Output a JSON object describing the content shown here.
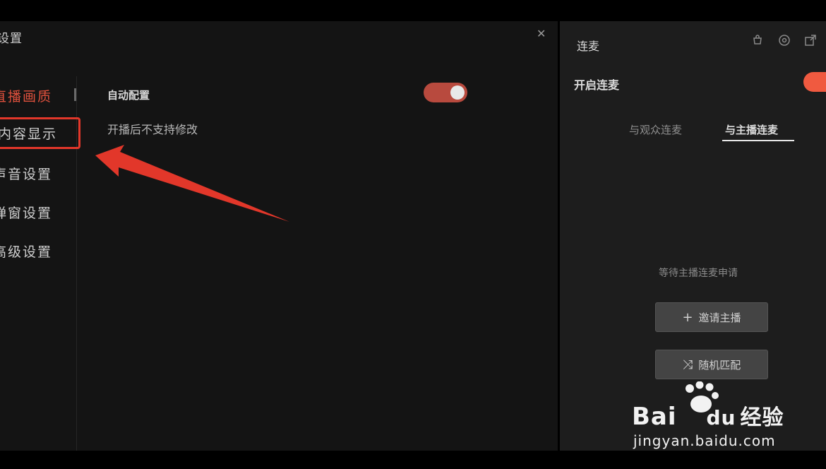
{
  "settings": {
    "title": "设置",
    "nav": [
      {
        "label": "直播画质",
        "active": true
      },
      {
        "label": "内容显示",
        "highlighted": true
      },
      {
        "label": "声音设置"
      },
      {
        "label": "弹窗设置"
      },
      {
        "label": "高级设置"
      }
    ],
    "content": {
      "auto_config_label": "自动配置",
      "auto_config_desc": "开播后不支持修改",
      "auto_config_on": true
    }
  },
  "mic_panel": {
    "title": "连麦",
    "enable_label": "开启连麦",
    "enable_on": true,
    "tabs": [
      "与观众连麦",
      "与主播连麦"
    ],
    "active_tab": 1,
    "waiting_text": "等待主播连麦申请",
    "invite_button": "邀请主播",
    "random_button": "随机匹配"
  },
  "watermark": {
    "brand": "Bai",
    "brand_du": "du",
    "brand_cn": "经验",
    "url": "jingyan.baidu.com"
  },
  "colors": {
    "accent": "#e0513d",
    "highlight_box": "#e2372a",
    "arrow": "#e2372a"
  },
  "icons": [
    "close-icon",
    "shop-icon",
    "settings-icon",
    "expand-icon",
    "plus-icon",
    "shuffle-icon",
    "baidu-paw-icon"
  ]
}
